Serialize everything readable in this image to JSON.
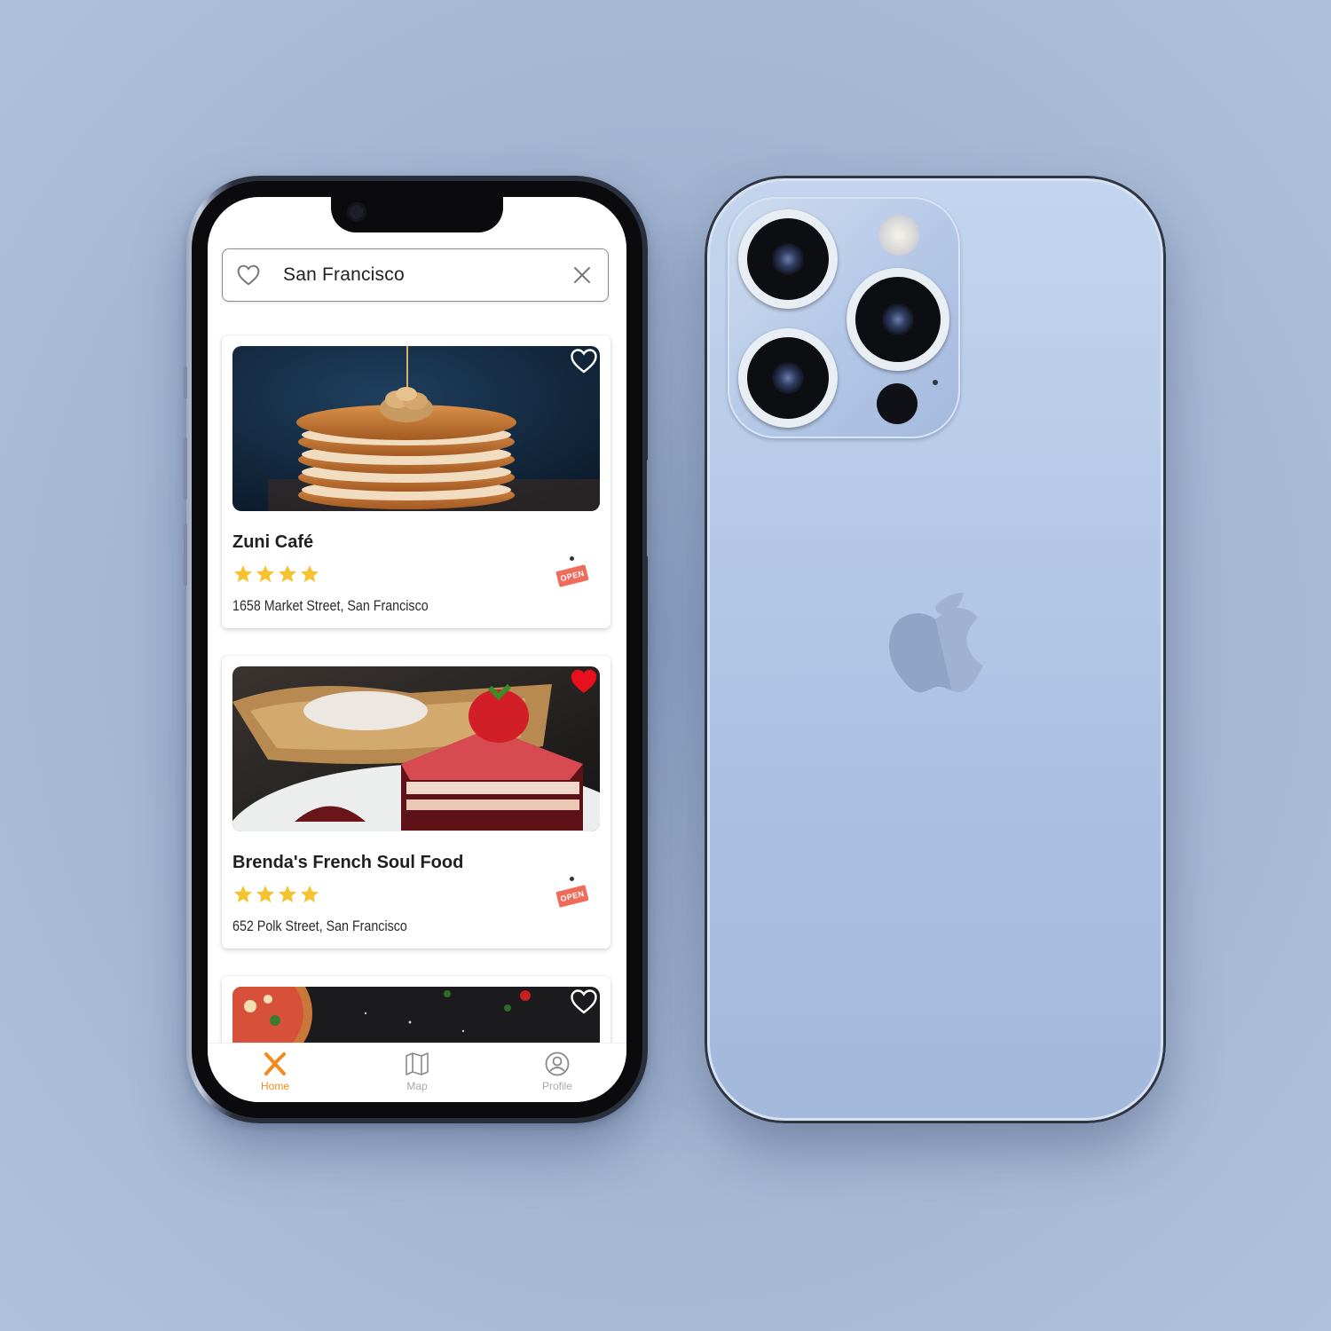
{
  "search": {
    "value": "San Francisco"
  },
  "restaurants": [
    {
      "name": "Zuni Café",
      "rating": 4,
      "address": "1658 Market Street, San Francisco",
      "status": "OPEN",
      "favorite": false,
      "photo": "pancakes"
    },
    {
      "name": "Brenda's French Soul Food",
      "rating": 4,
      "address": "652 Polk Street, San Francisco",
      "status": "OPEN",
      "favorite": true,
      "photo": "red-velvet-cake"
    },
    {
      "favorite": false,
      "photo": "pizza"
    }
  ],
  "tabs": [
    {
      "label": "Home",
      "icon": "fork-knife-icon",
      "active": true
    },
    {
      "label": "Map",
      "icon": "map-icon",
      "active": false
    },
    {
      "label": "Profile",
      "icon": "profile-icon",
      "active": false
    }
  ],
  "colors": {
    "accent": "#f28a1e",
    "favorite": "#e8101c",
    "open_sign": "#f06b5a",
    "star": "#f5c330",
    "background": "#a9bcd7"
  }
}
